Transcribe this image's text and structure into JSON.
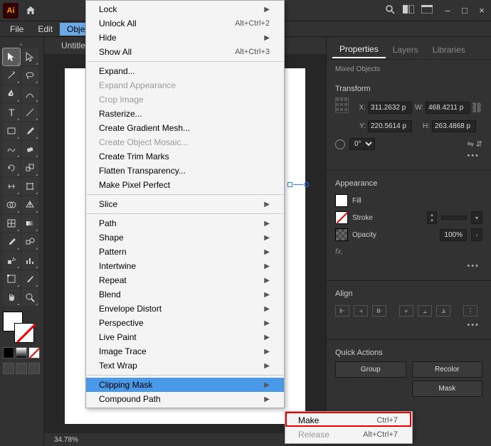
{
  "app": {
    "icon_text": "Ai"
  },
  "menubar": {
    "file": "File",
    "edit": "Edit",
    "object": "Object"
  },
  "doc": {
    "tab": "Untitle",
    "zoom": "34.78%"
  },
  "panel": {
    "tabs": {
      "properties": "Properties",
      "layers": "Layers",
      "libraries": "Libraries"
    },
    "selection": "Mixed Objects",
    "transform": {
      "title": "Transform",
      "x_lbl": "X:",
      "y_lbl": "Y:",
      "w_lbl": "W:",
      "h_lbl": "H:",
      "x": "311.2632 p",
      "y": "220.5614 p",
      "w": "468.4211 p",
      "h": "263.4868 p",
      "rotate_lbl": "⊿:",
      "rotate": "0°"
    },
    "appearance": {
      "title": "Appearance",
      "fill": "Fill",
      "stroke": "Stroke",
      "opacity": "Opacity",
      "opacity_val": "100%",
      "fx": "fx."
    },
    "align": {
      "title": "Align"
    },
    "quick": {
      "title": "Quick Actions",
      "group": "Group",
      "recolor": "Recolor",
      "mask": "Mask"
    }
  },
  "menu": {
    "lock": "Lock",
    "unlock_all": "Unlock All",
    "unlock_sc": "Alt+Ctrl+2",
    "hide": "Hide",
    "show_all": "Show All",
    "show_all_sc": "Alt+Ctrl+3",
    "expand": "Expand...",
    "expand_appearance": "Expand Appearance",
    "crop_image": "Crop Image",
    "rasterize": "Rasterize...",
    "create_gradient_mesh": "Create Gradient Mesh...",
    "create_object_mosaic": "Create Object Mosaic...",
    "create_trim_marks": "Create Trim Marks",
    "flatten_transparency": "Flatten Transparency...",
    "make_pixel_perfect": "Make Pixel Perfect",
    "slice": "Slice",
    "path": "Path",
    "shape": "Shape",
    "pattern": "Pattern",
    "intertwine": "Intertwine",
    "repeat": "Repeat",
    "blend": "Blend",
    "envelope_distort": "Envelope Distort",
    "perspective": "Perspective",
    "live_paint": "Live Paint",
    "image_trace": "Image Trace",
    "text_wrap": "Text Wrap",
    "clipping_mask": "Clipping Mask",
    "compound_path": "Compound Path"
  },
  "submenu": {
    "make": "Make",
    "make_sc": "Ctrl+7",
    "release": "Release",
    "release_sc": "Alt+Ctrl+7"
  }
}
